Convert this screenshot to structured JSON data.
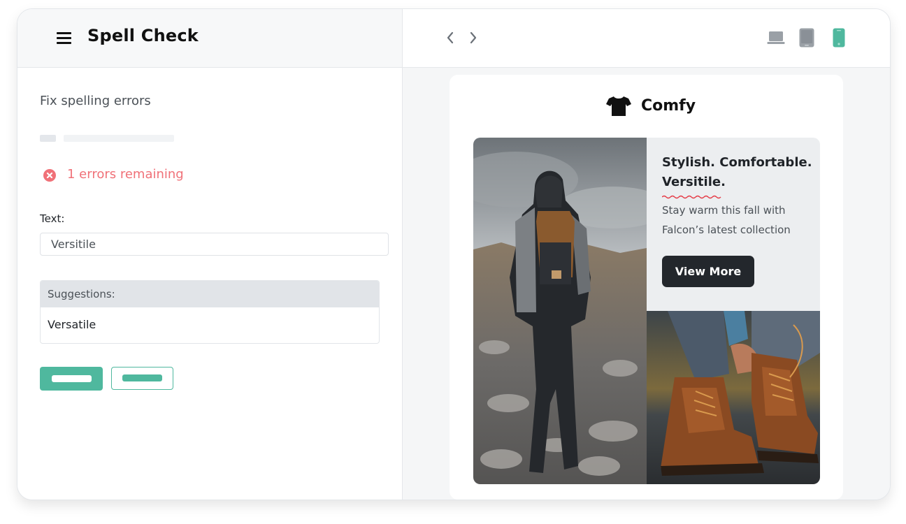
{
  "app": {
    "title": "Spell Check"
  },
  "icons": {
    "menu": "hamburger-icon",
    "prev": "chevron-left-icon",
    "next": "chevron-right-icon",
    "desktop": "laptop-icon",
    "tablet": "tablet-icon",
    "mobile": "mobile-icon",
    "error": "error-circle-icon",
    "brand": "t-shirt-icon"
  },
  "colors": {
    "accent": "#4fb89e",
    "error": "#f07178",
    "dark_button": "#23272c",
    "active_device": "#4fb89e"
  },
  "devices": {
    "active": "mobile"
  },
  "panel": {
    "heading": "Fix spelling errors",
    "error_status": "1 errors remaining",
    "text_label": "Text:",
    "text_value": "Versitile",
    "suggestions_header": "Suggestions:",
    "suggestions": [
      "Versatile"
    ]
  },
  "preview": {
    "brand_name": "Comfy",
    "headline": "Stylish. Comfortable. Versitile.",
    "body": "Stay warm this fall with Falcon’s latest collection",
    "cta_label": "View More",
    "misspelled_word": "Versitile"
  }
}
